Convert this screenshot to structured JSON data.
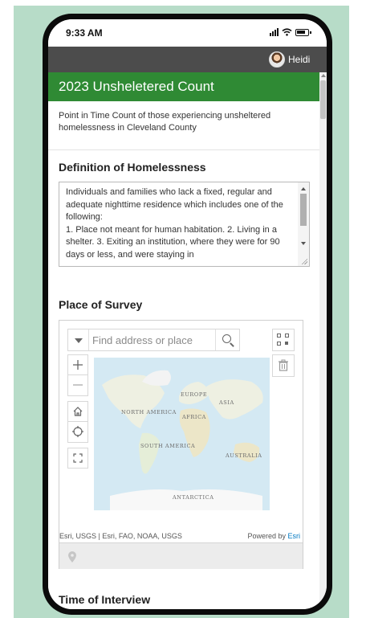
{
  "status": {
    "time": "9:33 AM"
  },
  "user": {
    "name": "Heidi"
  },
  "form": {
    "title": "2023 Unsheletered Count",
    "description": "Point in Time Count of those experiencing unsheltered homelessness in Cleveland County"
  },
  "questions": {
    "definition": {
      "label": "Definition of Homelessness",
      "text": "Individuals and families who lack a fixed, regular and adequate nighttime residence which includes one of the following:\n1. Place not meant for human habitation.  2. Living in a shelter.  3. Exiting an institution, where they were for 90 days or less, and were staying in"
    },
    "place": {
      "label": "Place of Survey",
      "search_placeholder": "Find address or place",
      "attribution": "Esri, USGS | Esri, FAO, NOAA, USGS",
      "powered_by": "Powered by",
      "powered_by_brand": "Esri"
    },
    "time": {
      "label": "Time of Interview"
    }
  },
  "map_labels": {
    "north_america": "NORTH AMERICA",
    "europe": "EUROPE",
    "asia": "ASIA",
    "africa": "AFRICA",
    "south_america": "SOUTH AMERICA",
    "australia": "AUSTRALIA",
    "antarctica": "ANTARCTICA"
  },
  "colors": {
    "header_green": "#2f8a34",
    "user_bar": "#4c4c4c",
    "backdrop": "#b7dcc8",
    "esri_link": "#0079c1"
  }
}
